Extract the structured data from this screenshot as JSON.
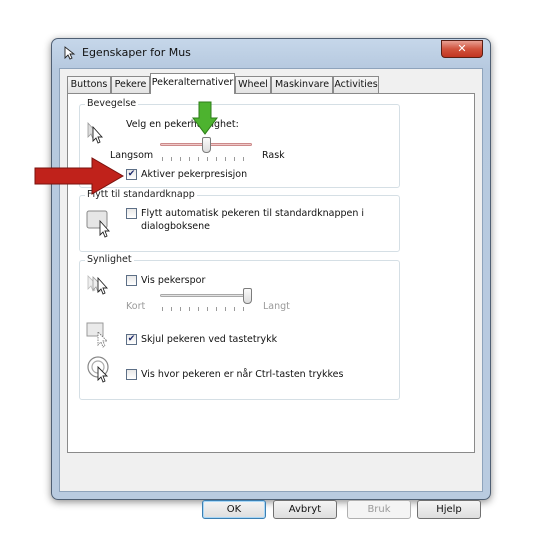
{
  "window": {
    "title": "Egenskaper for Mus",
    "close_label": "✕"
  },
  "tabs": [
    {
      "label": "Buttons",
      "active": false
    },
    {
      "label": "Pekere",
      "active": false
    },
    {
      "label": "Pekeralternativer",
      "active": true
    },
    {
      "label": "Wheel",
      "active": false
    },
    {
      "label": "Maskinvare",
      "active": false
    },
    {
      "label": "Activities",
      "active": false
    }
  ],
  "motion": {
    "group_title": "Bevegelse",
    "speed_label": "Velg en pekerhastighet:",
    "slow_label": "Langsom",
    "fast_label": "Rask",
    "speed_value": 0.5,
    "precision_label": "Aktiver pekerpresisjon",
    "precision_checked": true
  },
  "snap": {
    "group_title": "Flytt til standardknapp",
    "label_line1": "Flytt automatisk pekeren til standardknappen i",
    "label_line2": "dialogboksene",
    "checked": false
  },
  "visibility": {
    "group_title": "Synlighet",
    "trails_label": "Vis pekerspor",
    "trails_checked": false,
    "short_label": "Kort",
    "long_label": "Langt",
    "hide_label": "Skjul pekeren ved tastetrykk",
    "hide_checked": true,
    "ctrl_label": "Vis hvor pekeren er når Ctrl-tasten trykkes",
    "ctrl_checked": false
  },
  "buttons": {
    "ok": "OK",
    "cancel": "Avbryt",
    "apply": "Bruk",
    "help": "Hjelp"
  },
  "colors": {
    "red_arrow": "#c0221b",
    "green_arrow": "#4db32f"
  }
}
